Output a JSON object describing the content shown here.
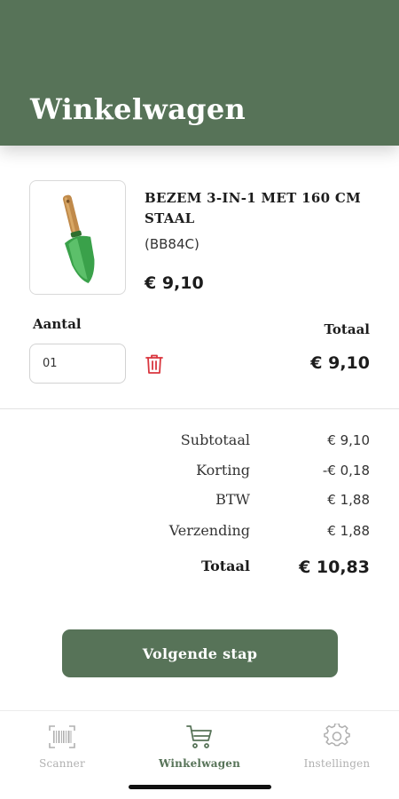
{
  "header": {
    "title": "Winkelwagen"
  },
  "cart_item": {
    "name": "BEZEM 3-IN-1 MET 160 CM STAAL",
    "sku": "(BB84C)",
    "price": "€ 9,10",
    "quantity_label": "Aantal",
    "quantity_value": "01",
    "total_label": "Totaal",
    "total_value": "€ 9,10",
    "image_icon": "garden-trowel"
  },
  "summary": {
    "rows": [
      {
        "label": "Subtotaal",
        "value": "€ 9,10"
      },
      {
        "label": "Korting",
        "value": "-€ 0,18"
      },
      {
        "label": "BTW",
        "value": "€ 1,88"
      },
      {
        "label": "Verzending",
        "value": "€ 1,88"
      }
    ],
    "total_label": "Totaal",
    "total_value": "€ 10,83"
  },
  "actions": {
    "next_label": "Volgende stap"
  },
  "tabbar": {
    "tabs": [
      {
        "label": "Scanner",
        "icon": "barcode-icon",
        "active": false
      },
      {
        "label": "Winkelwagen",
        "icon": "cart-icon",
        "active": true
      },
      {
        "label": "Instellingen",
        "icon": "gear-icon",
        "active": false
      }
    ]
  },
  "colors": {
    "brand_green": "#577358",
    "delete_red": "#d9363e",
    "inactive_gray": "#b0b0b0"
  }
}
